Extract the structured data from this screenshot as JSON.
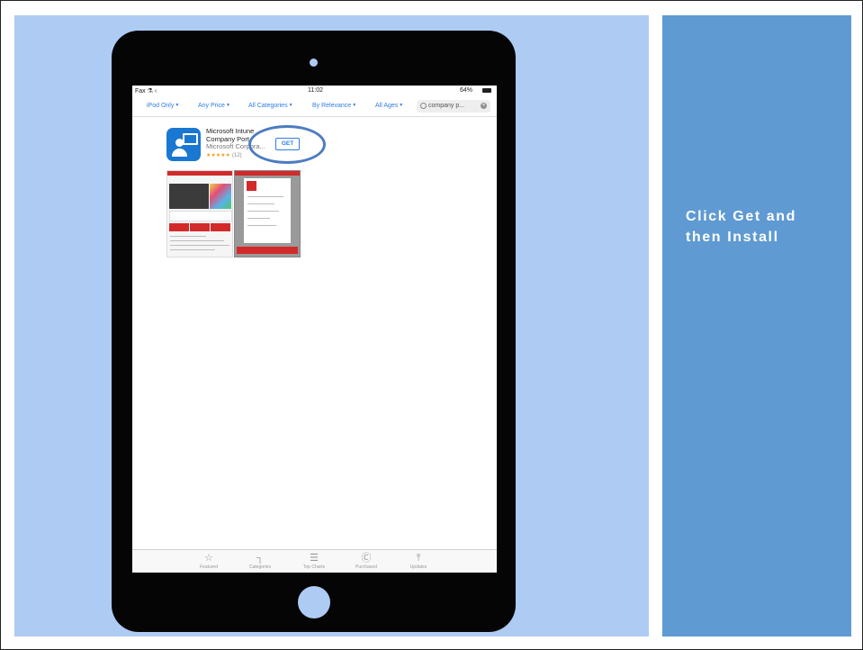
{
  "slide": {
    "caption": "Click Get and\nthen Install",
    "colors": {
      "left_panel": "#aecbf4",
      "right_panel": "#5f9ad2",
      "accent": "#2f7de1",
      "highlight": "#4d7cc1"
    }
  },
  "status_bar": {
    "carrier": "Fax ⚗ ‹",
    "time": "11:02",
    "battery": "64%"
  },
  "filters": [
    {
      "label": "iPod Only"
    },
    {
      "label": "Any Price"
    },
    {
      "label": "All Categories"
    },
    {
      "label": "By Relevance"
    },
    {
      "label": "All Ages"
    }
  ],
  "search": {
    "value": "company p..."
  },
  "app": {
    "name_line1": "Microsoft Intune",
    "name_line2": "Company Port",
    "publisher": "Microsoft Corpora...",
    "stars": "★★★★★",
    "rating_count": "(12)",
    "get_label": "GET",
    "icon": "company-portal-icon"
  },
  "tab_bar": [
    {
      "label": "Featured",
      "icon": "star-icon",
      "glyph": "☆"
    },
    {
      "label": "Categories",
      "icon": "categories-icon",
      "glyph": "┐"
    },
    {
      "label": "Top Charts",
      "icon": "top-charts-icon",
      "glyph": "☰"
    },
    {
      "label": "Purchased",
      "icon": "purchased-icon",
      "glyph": "Ⓒ"
    },
    {
      "label": "Updates",
      "icon": "updates-icon",
      "glyph": "⤒"
    }
  ]
}
